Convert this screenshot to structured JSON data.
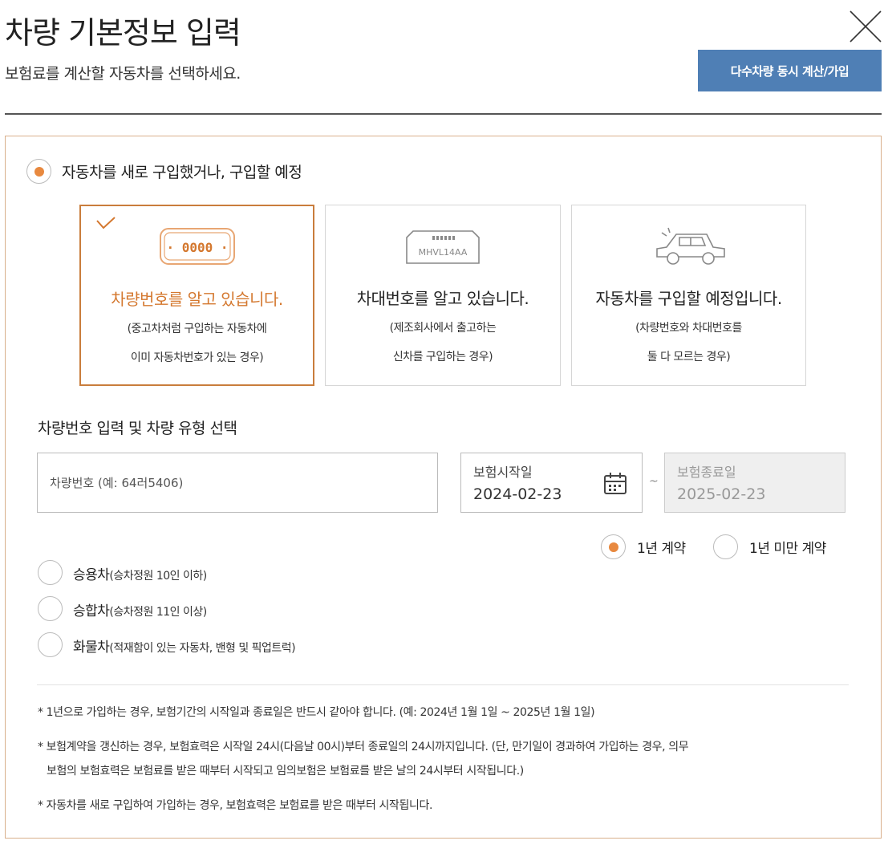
{
  "header": {
    "title": "차량 기본정보 입력",
    "subtitle": "보험료를 계산할 자동차를 선택하세요.",
    "multi_button": "다수차량 동시 계산/가입"
  },
  "purchase_option": {
    "label": "자동차를 새로 구입했거나, 구입할 예정",
    "checked": true
  },
  "cards": [
    {
      "icon_text": "· 0000 ·",
      "title": "차량번호를 알고 있습니다.",
      "desc_line1": "(중고차처럼 구입하는 자동차에",
      "desc_line2": "이미 자동차번호가 있는 경우)",
      "selected": true
    },
    {
      "icon_text": "MHVL14AA",
      "title": "차대번호를 알고 있습니다.",
      "desc_line1": "(제조회사에서 출고하는",
      "desc_line2": "신차를 구입하는 경우)",
      "selected": false
    },
    {
      "title": "자동차를 구입할 예정입니다.",
      "desc_line1": "(차량번호와 차대번호를",
      "desc_line2": "둘 다 모르는 경우)",
      "selected": false
    }
  ],
  "vehicle_section": {
    "heading": "차량번호 입력 및 차량 유형 선택",
    "plate_placeholder": "차량번호 (예: 64러5406)",
    "start_label": "보험시작일",
    "start_value": "2024-02-23",
    "end_label": "보험종료일",
    "end_value": "2025-02-23",
    "tilde": "~"
  },
  "contract": {
    "one_year": "1년 계약",
    "under_one_year": "1년 미만 계약",
    "selected": "one_year"
  },
  "vehicle_types": [
    {
      "name": "승용차",
      "sub": "(승차정원 10인 이하)"
    },
    {
      "name": "승합차",
      "sub": "(승차정원 11인 이상)"
    },
    {
      "name": "화물차",
      "sub": "(적재함이 있는 자동차, 밴형 및 픽업트럭)"
    }
  ],
  "notes": [
    "* 1년으로 가입하는 경우, 보험기간의 시작일과 종료일은 반드시 같아야 합니다. (예: 2024년 1월 1일 ~ 2025년 1월 1일)",
    "* 보험계약을 갱신하는 경우, 보험효력은 시작일 24시(다음날 00시)부터 종료일의 24시까지입니다. (단, 만기일이 경과하여 가입하는 경우, 의무",
    "보험의 보험효력은 보험료를 받은 때부터 시작되고 임의보험은 보험료를 받은 날의 24시부터 시작됩니다.)",
    "* 자동차를 새로 구입하여 가입하는 경우, 보험효력은 보험료를 받은 때부터 시작됩니다."
  ],
  "colors": {
    "accent_orange": "#e8893f",
    "selected_border": "#c97d3c",
    "button_blue": "#4f7fb5"
  }
}
